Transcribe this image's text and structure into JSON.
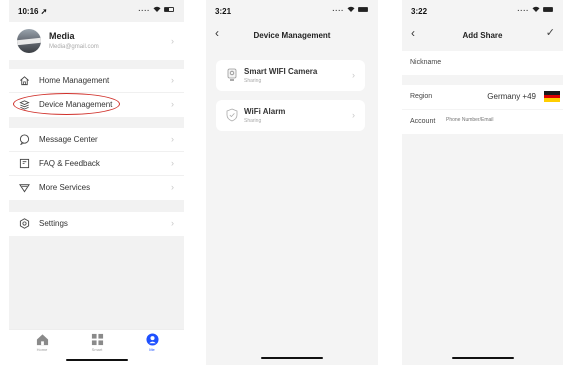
{
  "phone1": {
    "status": {
      "time": "10:16 ➚",
      "signal": "....",
      "battery_level": 0.5
    },
    "profile": {
      "name": "Media",
      "email": "Media@gmail.com"
    },
    "menu_group1": [
      {
        "label": "Home Management",
        "icon": "home-icon"
      },
      {
        "label": "Device Management",
        "icon": "device-stack-icon"
      }
    ],
    "menu_group2": [
      {
        "label": "Message Center",
        "icon": "message-icon"
      },
      {
        "label": "FAQ & Feedback",
        "icon": "faq-icon"
      },
      {
        "label": "More Services",
        "icon": "services-icon"
      }
    ],
    "menu_group3": [
      {
        "label": "Settings",
        "icon": "settings-icon"
      }
    ],
    "tabs": [
      {
        "label": "Home",
        "icon": "home-tab-icon",
        "active": false
      },
      {
        "label": "Smart",
        "icon": "smart-tab-icon",
        "active": false
      },
      {
        "label": "Me",
        "icon": "me-tab-icon",
        "active": true
      }
    ],
    "accent_color": "#1e50ff",
    "annotation_color": "#d0302a"
  },
  "phone2": {
    "status": {
      "time": "3:21",
      "signal": "....",
      "battery_level": 1.0
    },
    "nav": {
      "back": "‹",
      "title": "Device Management"
    },
    "cards": [
      {
        "title": "Smart WIFI Camera",
        "subtitle": "Sharing",
        "icon": "camera-icon"
      },
      {
        "title": "WiFi Alarm",
        "subtitle": "Sharing",
        "icon": "alarm-shield-icon"
      }
    ]
  },
  "phone3": {
    "status": {
      "time": "3:22",
      "signal": "....",
      "battery_level": 1.0
    },
    "nav": {
      "back": "‹",
      "title": "Add Share",
      "done": "✓"
    },
    "nickname_label": "Nickname",
    "region_label": "Region",
    "region_value": "Germany  +49",
    "account_label": "Account",
    "account_placeholder": "Phone Number/Email",
    "flag_colors": [
      "#1a1a1a",
      "#dd0000",
      "#ffce00"
    ]
  }
}
